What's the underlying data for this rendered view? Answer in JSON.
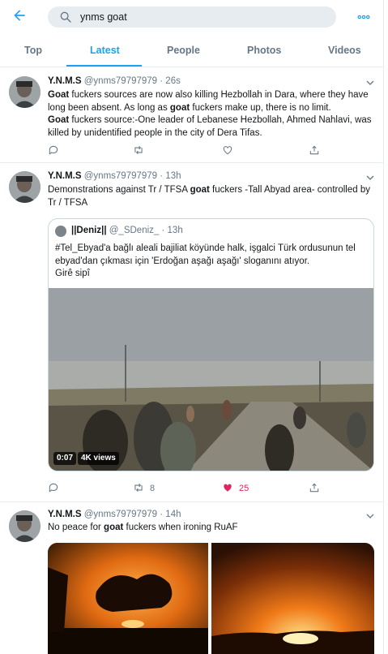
{
  "header": {
    "search_query": "ynms goat",
    "icons": {
      "back": "back-arrow-icon",
      "search": "search-icon",
      "more": "more-icon"
    }
  },
  "tabs": [
    {
      "label": "Top",
      "active": false
    },
    {
      "label": "Latest",
      "active": true
    },
    {
      "label": "People",
      "active": false
    },
    {
      "label": "Photos",
      "active": false
    },
    {
      "label": "Videos",
      "active": false
    }
  ],
  "colors": {
    "accent": "#1da1f2",
    "like": "#e0245e",
    "secondary_text": "#657786"
  },
  "tweets": [
    {
      "name": "Y.N.M.S",
      "handle": "@ynms79797979",
      "time": "· 26s",
      "text_segments": [
        {
          "b": "Goat"
        },
        {
          "t": " fuckers sources are now also killing Hezbollah in Dara, where they have long been absent. As long as "
        },
        {
          "b": "goat"
        },
        {
          "t": " fuckers make up, there is no limit."
        },
        {
          "br": true
        },
        {
          "b": "Goat"
        },
        {
          "t": " fuckers source:-One leader of Lebanese Hezbollah, Ahmed Nahlavi, was killed by unidentified people in the city of Dera Tifas."
        }
      ],
      "actions": {
        "reply": "",
        "retweet": "",
        "like": "",
        "share": ""
      }
    },
    {
      "name": "Y.N.M.S",
      "handle": "@ynms79797979",
      "time": "· 13h",
      "text_segments": [
        {
          "t": "Demonstrations against Tr / TFSA "
        },
        {
          "b": "goat"
        },
        {
          "t": " fuckers -Tall Abyad area-   controlled by Tr / TFSA"
        }
      ],
      "quote": {
        "name": "||Deniz||",
        "handle": "@_SDeniz_",
        "time": "· 13h",
        "text_lines": [
          "#Tel_Ebyad'a bağlı  aleali bajiliat köyünde halk, işgalci Türk ordusunun tel ebyad'dan çıkması için 'Erdoğan aşağı aşağı' sloganını atıyor.",
          "Girê sipî"
        ],
        "video_duration": "0:07",
        "video_views": "4K views"
      },
      "actions": {
        "reply": "",
        "retweet": "8",
        "like": "25",
        "share": ""
      }
    },
    {
      "name": "Y.N.M.S",
      "handle": "@ynms79797979",
      "time": "· 14h",
      "text_segments": [
        {
          "t": "No peace for "
        },
        {
          "b": "goat"
        },
        {
          "t": " fuckers when ironing RuAF"
        }
      ]
    }
  ]
}
